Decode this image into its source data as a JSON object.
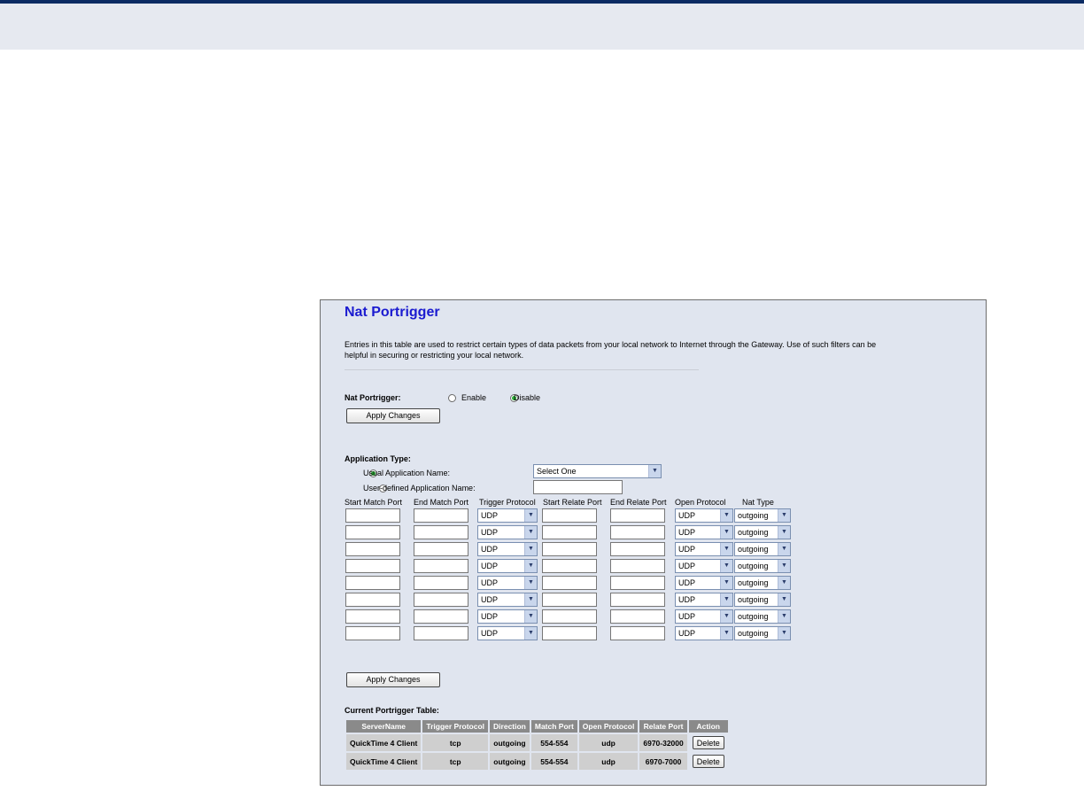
{
  "page": {
    "title": "Nat Portrigger",
    "description": "Entries in this table are used to restrict certain types of data packets from your local network to Internet through the Gateway. Use of such filters can be helpful in securing or restricting your local network."
  },
  "nat_portrigger": {
    "label": "Nat Portrigger:",
    "enable_label": "Enable",
    "disable_label": "Disable",
    "selected": "Disable",
    "apply_label": "Apply Changes"
  },
  "app_type": {
    "label": "Application Type:",
    "usual_label": "Usual Application Name:",
    "usual_selected": true,
    "usual_value": "Select One",
    "user_label": "User-defined Application Name:",
    "user_value": ""
  },
  "columns": [
    "Start Match Port",
    "End Match Port",
    "Trigger Protocol",
    "Start Relate Port",
    "End Relate Port",
    "Open Protocol",
    "Nat Type"
  ],
  "rows": [
    {
      "start_match": "",
      "end_match": "",
      "trigger": "UDP",
      "start_relate": "",
      "end_relate": "",
      "open": "UDP",
      "nat": "outgoing"
    },
    {
      "start_match": "",
      "end_match": "",
      "trigger": "UDP",
      "start_relate": "",
      "end_relate": "",
      "open": "UDP",
      "nat": "outgoing"
    },
    {
      "start_match": "",
      "end_match": "",
      "trigger": "UDP",
      "start_relate": "",
      "end_relate": "",
      "open": "UDP",
      "nat": "outgoing"
    },
    {
      "start_match": "",
      "end_match": "",
      "trigger": "UDP",
      "start_relate": "",
      "end_relate": "",
      "open": "UDP",
      "nat": "outgoing"
    },
    {
      "start_match": "",
      "end_match": "",
      "trigger": "UDP",
      "start_relate": "",
      "end_relate": "",
      "open": "UDP",
      "nat": "outgoing"
    },
    {
      "start_match": "",
      "end_match": "",
      "trigger": "UDP",
      "start_relate": "",
      "end_relate": "",
      "open": "UDP",
      "nat": "outgoing"
    },
    {
      "start_match": "",
      "end_match": "",
      "trigger": "UDP",
      "start_relate": "",
      "end_relate": "",
      "open": "UDP",
      "nat": "outgoing"
    },
    {
      "start_match": "",
      "end_match": "",
      "trigger": "UDP",
      "start_relate": "",
      "end_relate": "",
      "open": "UDP",
      "nat": "outgoing"
    }
  ],
  "apply2_label": "Apply Changes",
  "current_table": {
    "label": "Current Portrigger Table:",
    "headers": [
      "ServerName",
      "Trigger Protocol",
      "Direction",
      "Match Port",
      "Open Protocol",
      "Relate Port",
      "Action"
    ],
    "rows": [
      [
        "QuickTime 4 Client",
        "tcp",
        "outgoing",
        "554-554",
        "udp",
        "6970-32000",
        "Delete"
      ],
      [
        "QuickTime 4 Client",
        "tcp",
        "outgoing",
        "554-554",
        "udp",
        "6970-7000",
        "Delete"
      ]
    ]
  },
  "icons": {
    "dropdown_arrow": "chevron-down-icon"
  }
}
